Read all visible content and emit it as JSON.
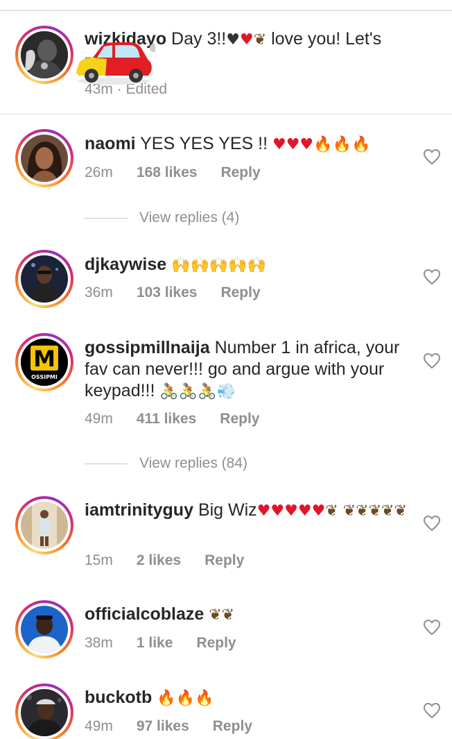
{
  "caption": {
    "username": "wizkidayo",
    "text_part1": "Day 3!!",
    "emojis1": [
      "black-heart",
      "red-heart",
      "eagle"
    ],
    "text_part2": " love you! Let's rage!",
    "meta": "43m · Edited",
    "colors": {
      "ring_start": "#feda75",
      "ring_end": "#962fbf"
    }
  },
  "comments": [
    {
      "username": "naomi",
      "text": "YES YES YES !!",
      "emojis": [
        "red-heart",
        "red-heart",
        "red-heart",
        "fire",
        "fire",
        "fire"
      ],
      "time": "26m",
      "likes": "168 likes",
      "reply": "Reply",
      "view_replies": "View replies (4)"
    },
    {
      "username": "djkaywise",
      "text": "",
      "emojis": [
        "raising-hands",
        "raising-hands",
        "raising-hands",
        "raising-hands",
        "raising-hands"
      ],
      "time": "36m",
      "likes": "103 likes",
      "reply": "Reply"
    },
    {
      "username": "gossipmillnaija",
      "text": "Number 1 in africa, your fav can never!!! go and argue with your keypad!!!",
      "emojis": [
        "cyclist",
        "cyclist",
        "cyclist",
        "dash"
      ],
      "time": "49m",
      "likes": "411 likes",
      "reply": "Reply",
      "view_replies": "View replies (84)",
      "avatar_text": "M",
      "avatar_subtext": "OSSIPMI"
    },
    {
      "username": "iamtrinityguy",
      "text": "Big Wiz",
      "emojis": [
        "red-heart",
        "red-heart",
        "red-heart",
        "red-heart",
        "red-heart",
        "eagle",
        "eagle",
        "eagle",
        "eagle",
        "eagle",
        "eagle"
      ],
      "time": "15m",
      "likes": "2 likes",
      "reply": "Reply"
    },
    {
      "username": "officialcoblaze",
      "text": "",
      "emojis": [
        "eagle",
        "eagle"
      ],
      "time": "38m",
      "likes": "1 like",
      "reply": "Reply"
    },
    {
      "username": "buckotb",
      "text": "",
      "emojis": [
        "fire",
        "fire",
        "fire"
      ],
      "time": "49m",
      "likes": "97 likes",
      "reply": "Reply"
    }
  ],
  "icons": {
    "like": "heart-outline-icon",
    "sticker": "car-sticker"
  }
}
